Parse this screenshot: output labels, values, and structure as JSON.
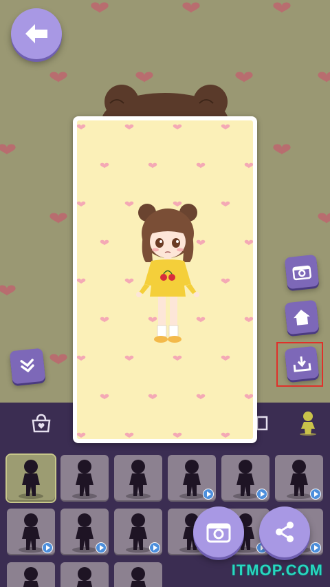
{
  "colors": {
    "background": "#9a9873",
    "heart_bg": "#b86d6f",
    "heart_card": "#f4a9b5",
    "card_fill": "#fbf0b8",
    "accent_purple": "#a898e4",
    "dark_purple": "#3b2d52",
    "highlight_red": "#e0302a",
    "watermark": "#27d7c0"
  },
  "top_bar": {
    "back_icon": "arrow-left-icon"
  },
  "side_buttons": [
    {
      "name": "camera",
      "icon": "camera-icon"
    },
    {
      "name": "home",
      "icon": "home-icon"
    },
    {
      "name": "download",
      "icon": "download-icon"
    }
  ],
  "collapse_button": {
    "icon": "double-chevron-down-icon"
  },
  "tabs": [
    {
      "icon": "bag-lock-icon"
    },
    {
      "icon": "frame-icon"
    },
    {
      "icon": "character-icon",
      "active": true
    }
  ],
  "poses": [
    {
      "selected": true,
      "video": false
    },
    {
      "selected": false,
      "video": false
    },
    {
      "selected": false,
      "video": false
    },
    {
      "selected": false,
      "video": true
    },
    {
      "selected": false,
      "video": true
    },
    {
      "selected": false,
      "video": true
    },
    {
      "selected": false,
      "video": true
    },
    {
      "selected": false,
      "video": true
    },
    {
      "selected": false,
      "video": true
    },
    {
      "selected": false,
      "video": true
    },
    {
      "selected": false,
      "video": true
    },
    {
      "selected": false,
      "video": true
    },
    {
      "selected": false,
      "video": false
    },
    {
      "selected": false,
      "video": false
    },
    {
      "selected": false,
      "video": false
    }
  ],
  "floating_buttons": [
    {
      "name": "camera",
      "icon": "camera-icon"
    },
    {
      "name": "share",
      "icon": "share-icon"
    }
  ],
  "watermark": "ITMOP.COM"
}
